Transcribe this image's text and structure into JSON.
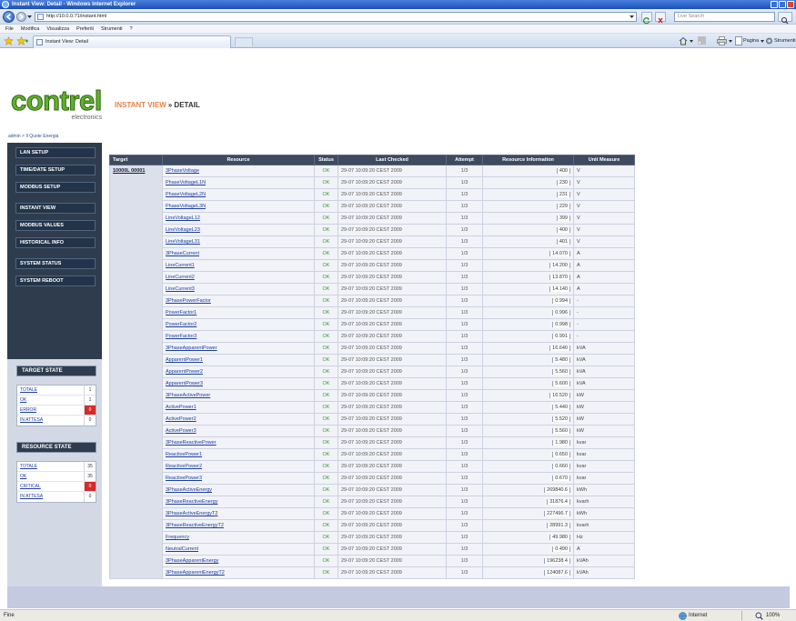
{
  "window": {
    "title": "Instant View: Detail - Windows Internet Explorer"
  },
  "address": {
    "url": "http://10.0.0.71/instant.html",
    "search_placeholder": "Live Search"
  },
  "menu": [
    "File",
    "Modifica",
    "Visualizza",
    "Preferiti",
    "Strumenti",
    "?"
  ],
  "tab": {
    "label": "Instant View: Detail"
  },
  "command_bar": {
    "page": "Pagina",
    "tools": "Strumenti"
  },
  "page": {
    "logo": {
      "name": "contrel",
      "tagline": "electronics"
    },
    "breadcrumb": "admin > Il Quote Energia",
    "heading": {
      "section": "INSTANT VIEW",
      "sub": "» DETAIL"
    },
    "nav": [
      "LAN SETUP",
      "TIME/DATE SETUP",
      "MODBUS SETUP",
      "INSTANT VIEW",
      "MODBUS VALUES",
      "HISTORICAL INFO",
      "SYSTEM STATUS",
      "SYSTEM REBOOT"
    ],
    "target_state": {
      "title": "TARGET STATE",
      "items": [
        {
          "label": "TOTALE",
          "value": "1"
        },
        {
          "label": "OK",
          "value": "1"
        },
        {
          "label": "ERROR",
          "value": "0",
          "alert": true
        },
        {
          "label": "IN ATTESA",
          "value": "0"
        }
      ]
    },
    "resource_state": {
      "title": "RESOURCE STATE",
      "items": [
        {
          "label": "TOTALE",
          "value": "35"
        },
        {
          "label": "OK",
          "value": "35"
        },
        {
          "label": "CRITICAL",
          "value": "0",
          "alert": true
        },
        {
          "label": "IN ATTESA",
          "value": "0"
        }
      ]
    },
    "table": {
      "headers": [
        "Target",
        "Resource",
        "Status",
        "Last Checked",
        "Attempt",
        "Resource Information",
        "Unit Measure"
      ],
      "target": "10000L 00001",
      "rows": [
        {
          "resource": "3PhaseVoltage",
          "status": "OK",
          "last_checked": "29-07 10:09:20 CEST 2009",
          "attempt": "1/3",
          "info": "400",
          "unit": "V"
        },
        {
          "resource": "PhaseVoltageL1N",
          "status": "OK",
          "last_checked": "29-07 10:09:20 CEST 2009",
          "attempt": "1/3",
          "info": "230",
          "unit": "V"
        },
        {
          "resource": "PhaseVoltageL2N",
          "status": "OK",
          "last_checked": "29-07 10:09:20 CEST 2009",
          "attempt": "1/3",
          "info": "231",
          "unit": "V"
        },
        {
          "resource": "PhaseVoltageL3N",
          "status": "OK",
          "last_checked": "29-07 10:09:20 CEST 2009",
          "attempt": "1/3",
          "info": "229",
          "unit": "V"
        },
        {
          "resource": "LineVoltageL12",
          "status": "OK",
          "last_checked": "29-07 10:09:20 CEST 2009",
          "attempt": "1/3",
          "info": "399",
          "unit": "V"
        },
        {
          "resource": "LineVoltageL23",
          "status": "OK",
          "last_checked": "29-07 10:09:20 CEST 2009",
          "attempt": "1/3",
          "info": "400",
          "unit": "V"
        },
        {
          "resource": "LineVoltageL31",
          "status": "OK",
          "last_checked": "29-07 10:09:20 CEST 2009",
          "attempt": "1/3",
          "info": "401",
          "unit": "V"
        },
        {
          "resource": "3PhaseCurrent",
          "status": "OK",
          "last_checked": "29-07 10:09:20 CEST 2009",
          "attempt": "1/3",
          "info": "14.070",
          "unit": "A"
        },
        {
          "resource": "LineCurrent1",
          "status": "OK",
          "last_checked": "29-07 10:09:20 CEST 2009",
          "attempt": "1/3",
          "info": "14.200",
          "unit": "A"
        },
        {
          "resource": "LineCurrent2",
          "status": "OK",
          "last_checked": "29-07 10:09:20 CEST 2009",
          "attempt": "1/3",
          "info": "13.870",
          "unit": "A"
        },
        {
          "resource": "LineCurrent3",
          "status": "OK",
          "last_checked": "29-07 10:09:20 CEST 2009",
          "attempt": "1/3",
          "info": "14.140",
          "unit": "A"
        },
        {
          "resource": "3PhasePowerFactor",
          "status": "OK",
          "last_checked": "29-07 10:09:20 CEST 2009",
          "attempt": "1/3",
          "info": "0.994",
          "unit": "-"
        },
        {
          "resource": "PowerFactor1",
          "status": "OK",
          "last_checked": "29-07 10:09:20 CEST 2009",
          "attempt": "1/3",
          "info": "0.996",
          "unit": "-"
        },
        {
          "resource": "PowerFactor2",
          "status": "OK",
          "last_checked": "29-07 10:09:20 CEST 2009",
          "attempt": "1/3",
          "info": "0.998",
          "unit": "-"
        },
        {
          "resource": "PowerFactor3",
          "status": "OK",
          "last_checked": "29-07 10:09:20 CEST 2009",
          "attempt": "1/3",
          "info": "0.991",
          "unit": "-"
        },
        {
          "resource": "3PhaseApparentPower",
          "status": "OK",
          "last_checked": "29-07 10:09:20 CEST 2009",
          "attempt": "1/3",
          "info": "16.640",
          "unit": "kVA"
        },
        {
          "resource": "ApparentPower1",
          "status": "OK",
          "last_checked": "29-07 10:09:20 CEST 2009",
          "attempt": "1/3",
          "info": "5.480",
          "unit": "kVA"
        },
        {
          "resource": "ApparentPower2",
          "status": "OK",
          "last_checked": "29-07 10:09:20 CEST 2009",
          "attempt": "1/3",
          "info": "5.560",
          "unit": "kVA"
        },
        {
          "resource": "ApparentPower3",
          "status": "OK",
          "last_checked": "29-07 10:09:20 CEST 2009",
          "attempt": "1/3",
          "info": "5.600",
          "unit": "kVA"
        },
        {
          "resource": "3PhaseActivePower",
          "status": "OK",
          "last_checked": "29-07 10:09:20 CEST 2009",
          "attempt": "1/3",
          "info": "16.520",
          "unit": "kW"
        },
        {
          "resource": "ActivePower1",
          "status": "OK",
          "last_checked": "29-07 10:09:20 CEST 2009",
          "attempt": "1/3",
          "info": "5.440",
          "unit": "kW"
        },
        {
          "resource": "ActivePower2",
          "status": "OK",
          "last_checked": "29-07 10:09:20 CEST 2009",
          "attempt": "1/3",
          "info": "5.520",
          "unit": "kW"
        },
        {
          "resource": "ActivePower3",
          "status": "OK",
          "last_checked": "29-07 10:09:20 CEST 2009",
          "attempt": "1/3",
          "info": "5.560",
          "unit": "kW"
        },
        {
          "resource": "3PhaseReactivePower",
          "status": "OK",
          "last_checked": "29-07 10:09:20 CEST 2009",
          "attempt": "1/3",
          "info": "1.980",
          "unit": "kvar"
        },
        {
          "resource": "ReactivePower1",
          "status": "OK",
          "last_checked": "29-07 10:09:20 CEST 2009",
          "attempt": "1/3",
          "info": "0.650",
          "unit": "kvar"
        },
        {
          "resource": "ReactivePower2",
          "status": "OK",
          "last_checked": "29-07 10:09:20 CEST 2009",
          "attempt": "1/3",
          "info": "0.660",
          "unit": "kvar"
        },
        {
          "resource": "ReactivePower3",
          "status": "OK",
          "last_checked": "29-07 10:09:20 CEST 2009",
          "attempt": "1/3",
          "info": "0.670",
          "unit": "kvar"
        },
        {
          "resource": "3PhaseActiveEnergy",
          "status": "OK",
          "last_checked": "29-07 10:09:20 CEST 2009",
          "attempt": "1/3",
          "info": "269840.6",
          "unit": "kWh"
        },
        {
          "resource": "3PhaseReactiveEnergy",
          "status": "OK",
          "last_checked": "29-07 10:09:20 CEST 2009",
          "attempt": "1/3",
          "info": "31876.4",
          "unit": "kvarh"
        },
        {
          "resource": "3PhaseActiveEnergyT2",
          "status": "OK",
          "last_checked": "29-07 10:09:20 CEST 2009",
          "attempt": "1/3",
          "info": "227496.7",
          "unit": "kWh"
        },
        {
          "resource": "3PhaseReactiveEnergyT2",
          "status": "OK",
          "last_checked": "29-07 10:09:20 CEST 2009",
          "attempt": "1/3",
          "info": "28991.3",
          "unit": "kvarh"
        },
        {
          "resource": "Frequency",
          "status": "OK",
          "last_checked": "29-07 10:09:20 CEST 2009",
          "attempt": "1/3",
          "info": "49.980",
          "unit": "Hz"
        },
        {
          "resource": "NeutralCurrent",
          "status": "OK",
          "last_checked": "29-07 10:09:20 CEST 2009",
          "attempt": "1/3",
          "info": "0.490",
          "unit": "A"
        },
        {
          "resource": "3PhaseApparentEnergy",
          "status": "OK",
          "last_checked": "29-07 10:09:20 CEST 2009",
          "attempt": "1/3",
          "info": "196238.4",
          "unit": "kVAh"
        },
        {
          "resource": "3PhaseApparentEnergyT2",
          "status": "OK",
          "last_checked": "29-07 10:09:20 CEST 2009",
          "attempt": "1/3",
          "info": "124087.6",
          "unit": "kVAh"
        }
      ]
    }
  },
  "status_bar": {
    "text": "Fine",
    "zone": "Internet",
    "zoom": "100%"
  },
  "icons": [
    "ie-logo-icon",
    "back-icon",
    "forward-icon",
    "page-icon",
    "refresh-icon",
    "stop-icon",
    "search-icon",
    "favorites-star-icon",
    "add-favorites-icon",
    "home-icon",
    "feed-icon",
    "print-icon",
    "globe-icon",
    "zoom-icon"
  ],
  "colors": {
    "accent_orange": "#e9834a",
    "logo_green": "#63b02e",
    "nav_bg": "#2e3c4e",
    "table_header_bg": "#3d4a60",
    "status_ok": "#3a9a3a",
    "alert_red": "#d62a2a",
    "footer_band": "#c4cadf"
  }
}
